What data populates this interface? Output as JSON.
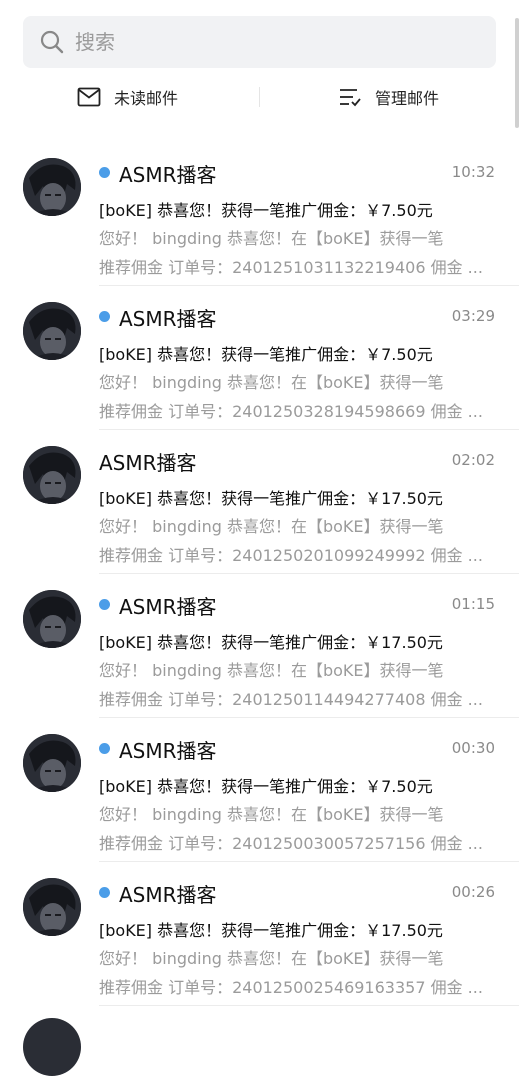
{
  "search": {
    "placeholder": "搜索",
    "icon": "search-icon"
  },
  "actions": {
    "unread": {
      "label": "未读邮件",
      "icon": "envelope-icon"
    },
    "manage": {
      "label": "管理邮件",
      "icon": "checklist-icon"
    }
  },
  "colors": {
    "unread_dot": "#4b9de8",
    "search_bg": "#f1f2f4",
    "preview_text": "#9b9b9b"
  },
  "emails": [
    {
      "sender": "ASMR播客",
      "unread": true,
      "time": "10:32",
      "subject": "[boKE] 恭喜您！获得一笔推广佣金：￥7.50元",
      "preview1": "您好！ bingding 恭喜您！在【boKE】获得一笔",
      "preview2": "推荐佣金 订单号：2401251031132219406 佣金 ..."
    },
    {
      "sender": "ASMR播客",
      "unread": true,
      "time": "03:29",
      "subject": "[boKE] 恭喜您！获得一笔推广佣金：￥7.50元",
      "preview1": "您好！ bingding 恭喜您！在【boKE】获得一笔",
      "preview2": "推荐佣金 订单号：2401250328194598669 佣金 ..."
    },
    {
      "sender": "ASMR播客",
      "unread": false,
      "time": "02:02",
      "subject": "[boKE] 恭喜您！获得一笔推广佣金：￥17.50元",
      "preview1": "您好！ bingding 恭喜您！在【boKE】获得一笔",
      "preview2": "推荐佣金 订单号：2401250201099249992 佣金 ..."
    },
    {
      "sender": "ASMR播客",
      "unread": true,
      "time": "01:15",
      "subject": "[boKE] 恭喜您！获得一笔推广佣金：￥17.50元",
      "preview1": "您好！ bingding 恭喜您！在【boKE】获得一笔",
      "preview2": "推荐佣金 订单号：2401250114494277408 佣金 ..."
    },
    {
      "sender": "ASMR播客",
      "unread": true,
      "time": "00:30",
      "subject": "[boKE] 恭喜您！获得一笔推广佣金：￥7.50元",
      "preview1": "您好！ bingding 恭喜您！在【boKE】获得一笔",
      "preview2": "推荐佣金 订单号：2401250030057257156 佣金 ..."
    },
    {
      "sender": "ASMR播客",
      "unread": true,
      "time": "00:26",
      "subject": "[boKE] 恭喜您！获得一笔推广佣金：￥17.50元",
      "preview1": "您好！ bingding 恭喜您！在【boKE】获得一笔",
      "preview2": "推荐佣金 订单号：2401250025469163357 佣金 ..."
    }
  ]
}
